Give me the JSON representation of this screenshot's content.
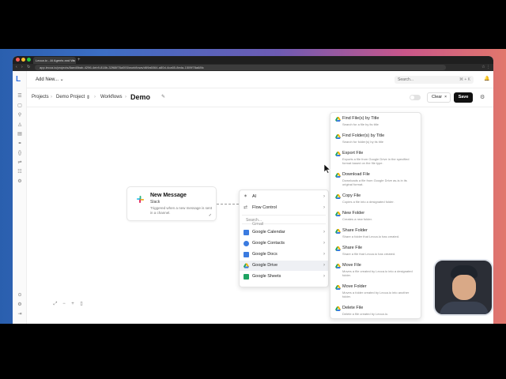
{
  "browser": {
    "tab_title": "Lecca.io - AI Agents and Wo",
    "tab_close": "×",
    "new_tab": "+",
    "nav_buttons": "‹ › ↻",
    "url": "app.lecca.io/projects/8aed8bab-4296-4eb9-818b-32f68f76a593/workflows/d69a6064-a80d-4ca65-8eda-1509f78a68fc",
    "icons": "☆ ⋮"
  },
  "sidebar": {
    "logo": "L",
    "items": [
      {
        "icon": "☰"
      },
      {
        "icon": "▢"
      },
      {
        "icon": "⚲"
      },
      {
        "icon": "◬"
      },
      {
        "icon": "▤"
      },
      {
        "icon": "⚭"
      },
      {
        "icon": "{}"
      },
      {
        "icon": "⇌"
      },
      {
        "icon": "☷"
      },
      {
        "icon": "⚙"
      }
    ],
    "bottom": [
      {
        "icon": "⊙"
      },
      {
        "icon": "⚙"
      },
      {
        "icon": "⇥"
      }
    ]
  },
  "topbar": {
    "add_new": "Add New... ⌄",
    "search_placeholder": "Search...",
    "search_shortcut": "⌘ + K",
    "bell": "🔔",
    "avatar": "i"
  },
  "breadcrumbs": {
    "projects": "Projects",
    "project": "Demo Project",
    "project_switch": "⇕",
    "workflows": "Workflows",
    "title": "Demo",
    "edit": "✎",
    "sep": "›"
  },
  "actions": {
    "clear": "Clear",
    "clear_icon": "×",
    "save": "Save",
    "settings": "⚙"
  },
  "node": {
    "title": "New Message",
    "app": "Slack",
    "description": "Triggered when a new message is sent in a channel.",
    "status": "✓"
  },
  "menu": {
    "search_placeholder": "Search...",
    "chevron": "›",
    "top_items": [
      {
        "label": "AI",
        "icon_color": "#6b6b6b"
      },
      {
        "label": "Flow Control",
        "icon_color": "#6b6b6b"
      }
    ],
    "items": [
      {
        "label": "Gmail",
        "icon_color": "#d64a3b"
      },
      {
        "label": "Google Calendar",
        "icon_color": "#3b7be0"
      },
      {
        "label": "Google Contacts",
        "icon_color": "#3b7be0"
      },
      {
        "label": "Google Docs",
        "icon_color": "#3b7be0"
      },
      {
        "label": "Google Drive",
        "icon_color": "#f2b300"
      },
      {
        "label": "Google Sheets",
        "icon_color": "#1ea362"
      }
    ]
  },
  "submenu": {
    "items": [
      {
        "title": "Find File(s) by Title",
        "desc": "Search for a file by its title"
      },
      {
        "title": "Find Folder(s) by Title",
        "desc": "Search for folder(s) by its title"
      },
      {
        "title": "Export File",
        "desc": "Exports a file from Google Drive in the specified format based on the file type."
      },
      {
        "title": "Download File",
        "desc": "Downloads a file from Google Drive as-is in its original format."
      },
      {
        "title": "Copy File",
        "desc": "Copies a file into a designated folder."
      },
      {
        "title": "New Folder",
        "desc": "Creates a new folder."
      },
      {
        "title": "Share Folder",
        "desc": "Share a folder that Lecca.io has created."
      },
      {
        "title": "Share File",
        "desc": "Share a file that Lecca.io has created."
      },
      {
        "title": "Move File",
        "desc": "Moves a file created by Lecca.io into a designated folder."
      },
      {
        "title": "Move Folder",
        "desc": "Moves a folder created by Lecca.io into another folder."
      },
      {
        "title": "Delete File",
        "desc": "Delete a file created by Lecca.io."
      }
    ]
  },
  "zoom": {
    "fit": "⤢",
    "zoom_out": "−",
    "zoom_in": "+",
    "lock": "▯"
  },
  "colors": {
    "accent": "#2f6fe0",
    "save_button": "#111111"
  }
}
